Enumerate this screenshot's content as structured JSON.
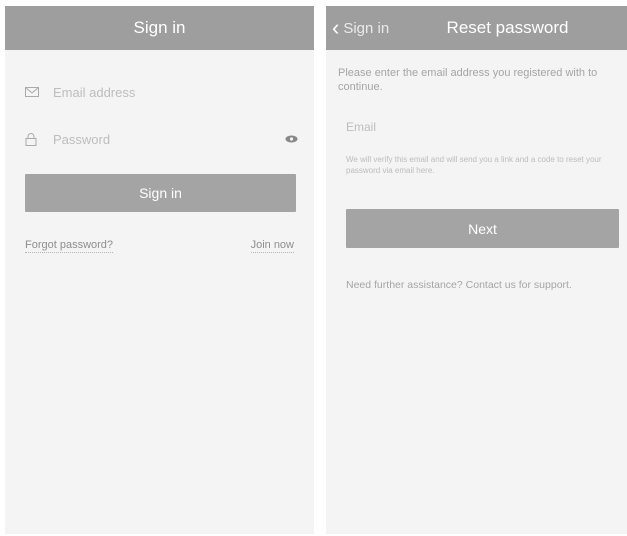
{
  "signin": {
    "title": "Sign in",
    "email_placeholder": "Email address",
    "password_placeholder": "Password",
    "signin_button": "Sign in",
    "forgot_link": "Forgot password?",
    "join_link": "Join now"
  },
  "reset": {
    "back_label": "Sign in",
    "title": "Reset password",
    "instruction": "Please enter the email address you registered with to continue.",
    "email_placeholder": "Email",
    "note": "We will verify this email and will send you a link and a code to reset your password via email here.",
    "next_button": "Next",
    "support_text": "Need further assistance? Contact us for support."
  },
  "icons": {
    "email": "envelope-icon",
    "password": "lock-icon",
    "show_password": "eye-icon",
    "back": "chevron-left-icon"
  }
}
